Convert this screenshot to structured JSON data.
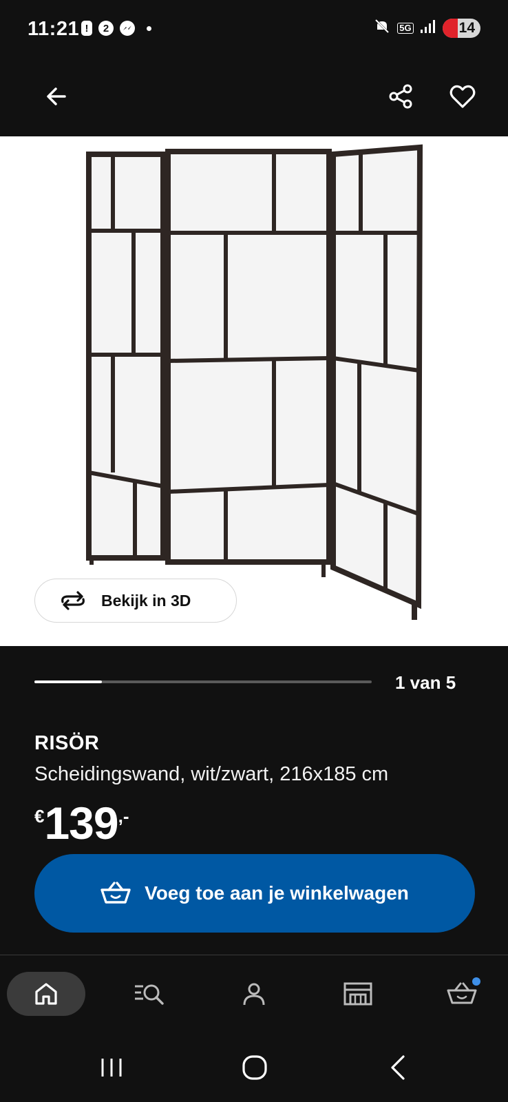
{
  "status_bar": {
    "time": "11:21",
    "notifications": [
      "!",
      "2"
    ],
    "network": "5G",
    "battery": "14"
  },
  "header": {
    "back_icon": "arrow-left-icon",
    "share_icon": "share-icon",
    "favorite_icon": "heart-icon"
  },
  "product_image": {
    "view_3d_label": "Bekijk in 3D",
    "view_3d_icon": "rotate-3d-icon"
  },
  "carousel": {
    "counter": "1 van 5",
    "current": 1,
    "total": 5
  },
  "product": {
    "name": "RISÖR",
    "description": "Scheidingswand, wit/zwart, 216x185 cm",
    "price_currency": "€",
    "price_amount": "139",
    "price_suffix": ",-"
  },
  "add_to_cart": {
    "label": "Voeg toe aan je winkelwagen",
    "icon": "basket-icon"
  },
  "bottom_nav": {
    "items": [
      "home-icon",
      "search-list-icon",
      "profile-icon",
      "store-icon",
      "cart-icon"
    ],
    "active": "home-icon"
  },
  "colors": {
    "background": "#111111",
    "accent_blue": "#0058a3",
    "badge_blue": "#3e8fe8",
    "battery_red": "#e0232b"
  }
}
